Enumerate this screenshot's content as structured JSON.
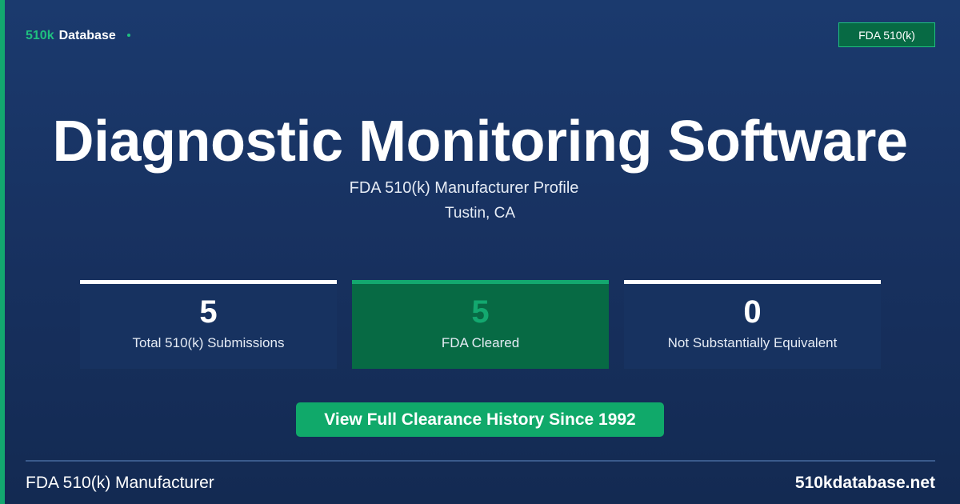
{
  "brand": {
    "part1": "510k",
    "part2": "Database"
  },
  "badge": "FDA 510(k)",
  "title": "Diagnostic Monitoring Software",
  "subtitle": "FDA 510(k) Manufacturer Profile",
  "location": "Tustin, CA",
  "stats": [
    {
      "value": "5",
      "label": "Total 510(k) Submissions"
    },
    {
      "value": "5",
      "label": "FDA Cleared"
    },
    {
      "value": "0",
      "label": "Not Substantially Equivalent"
    }
  ],
  "cta": "View Full Clearance History Since 1992",
  "footer": {
    "left": "FDA 510(k) Manufacturer",
    "right": "510kdatabase.net"
  },
  "colors": {
    "accent": "#13a86f",
    "background": "#1b3a6e",
    "highlight_card": "#076a44"
  }
}
